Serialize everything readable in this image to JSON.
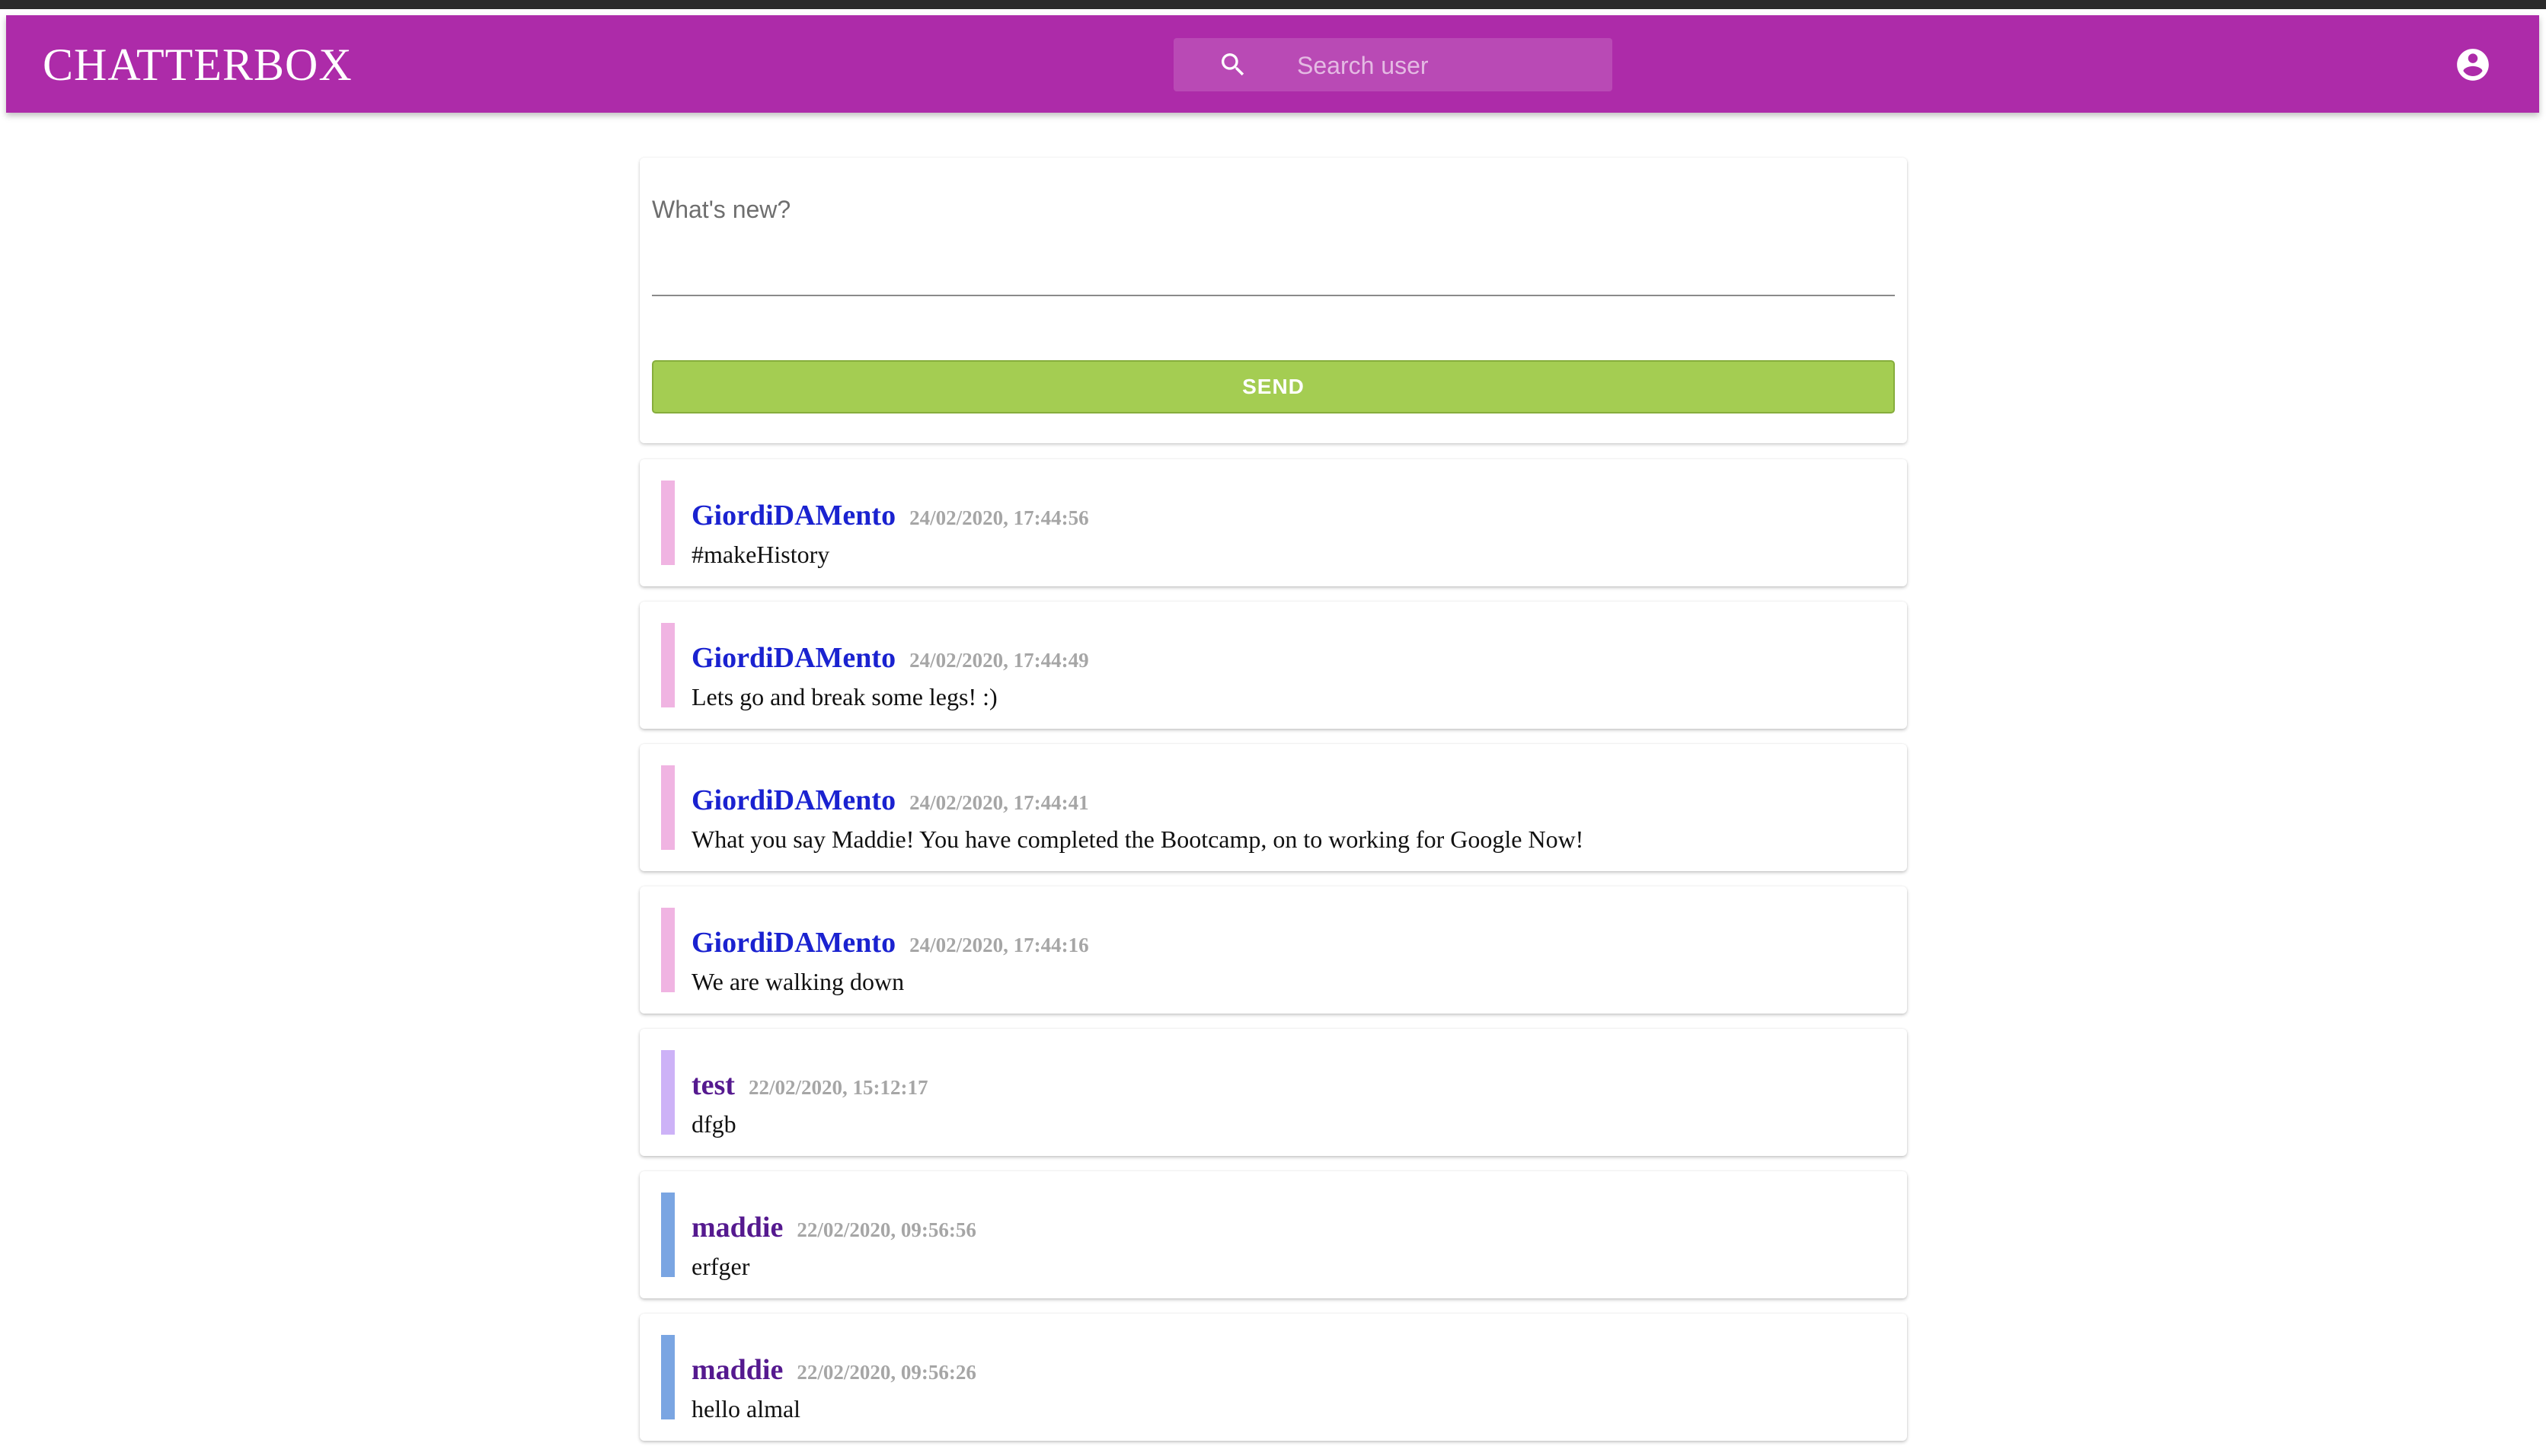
{
  "appbar": {
    "brand": "CHATTERBOX",
    "search_placeholder": "Search user",
    "color": "#ad2ba9"
  },
  "composer": {
    "placeholder": "What's new?",
    "value": "",
    "send_label": "SEND",
    "send_color": "#a4cd52"
  },
  "messages": [
    {
      "author": "GiordiDAMento",
      "time": "24/02/2020, 17:44:56",
      "text": "#makeHistory",
      "bar_color": "#f0b4e2",
      "name_color": "#1a22d0"
    },
    {
      "author": "GiordiDAMento",
      "time": "24/02/2020, 17:44:49",
      "text": "Lets go and break some legs! :)",
      "bar_color": "#f0b4e2",
      "name_color": "#1a22d0"
    },
    {
      "author": "GiordiDAMento",
      "time": "24/02/2020, 17:44:41",
      "text": "What you say Maddie! You have completed the Bootcamp, on to working for Google Now!",
      "bar_color": "#f0b4e2",
      "name_color": "#1a22d0"
    },
    {
      "author": "GiordiDAMento",
      "time": "24/02/2020, 17:44:16",
      "text": "We are walking down",
      "bar_color": "#f0b4e2",
      "name_color": "#1a22d0"
    },
    {
      "author": "test",
      "time": "22/02/2020, 15:12:17",
      "text": "dfgb",
      "bar_color": "#cdb2f7",
      "name_color": "#55198f"
    },
    {
      "author": "maddie",
      "time": "22/02/2020, 09:56:56",
      "text": "erfger",
      "bar_color": "#7aa5e2",
      "name_color": "#55198f"
    },
    {
      "author": "maddie",
      "time": "22/02/2020, 09:56:26",
      "text": "hello almal",
      "bar_color": "#7aa5e2",
      "name_color": "#55198f"
    }
  ]
}
